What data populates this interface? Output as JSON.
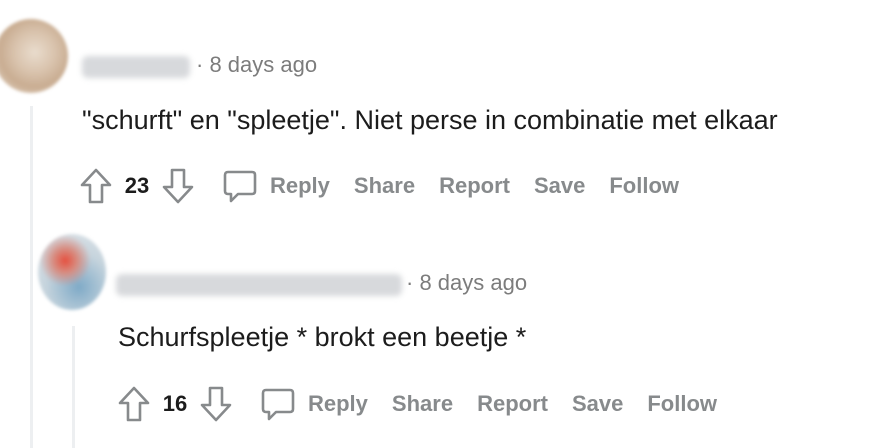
{
  "comments": [
    {
      "time": "· 8 days ago",
      "text": "\"schurft\" en \"spleetje\". Niet perse in combinatie met elkaar",
      "votes": "23",
      "actions": {
        "reply": "Reply",
        "share": "Share",
        "report": "Report",
        "save": "Save",
        "follow": "Follow"
      }
    },
    {
      "time": "· 8 days ago",
      "text": "Schurfspleetje * brokt een beetje *",
      "votes": "16",
      "actions": {
        "reply": "Reply",
        "share": "Share",
        "report": "Report",
        "save": "Save",
        "follow": "Follow"
      }
    }
  ],
  "icons": {
    "upvote": "arrow-up-outline",
    "downvote": "arrow-down-outline",
    "reply": "speech-bubble-outline"
  },
  "colors": {
    "text": "#1c1c1c",
    "meta": "#7c7c7c",
    "action": "#878a8c",
    "thread_line": "#edeff1"
  }
}
